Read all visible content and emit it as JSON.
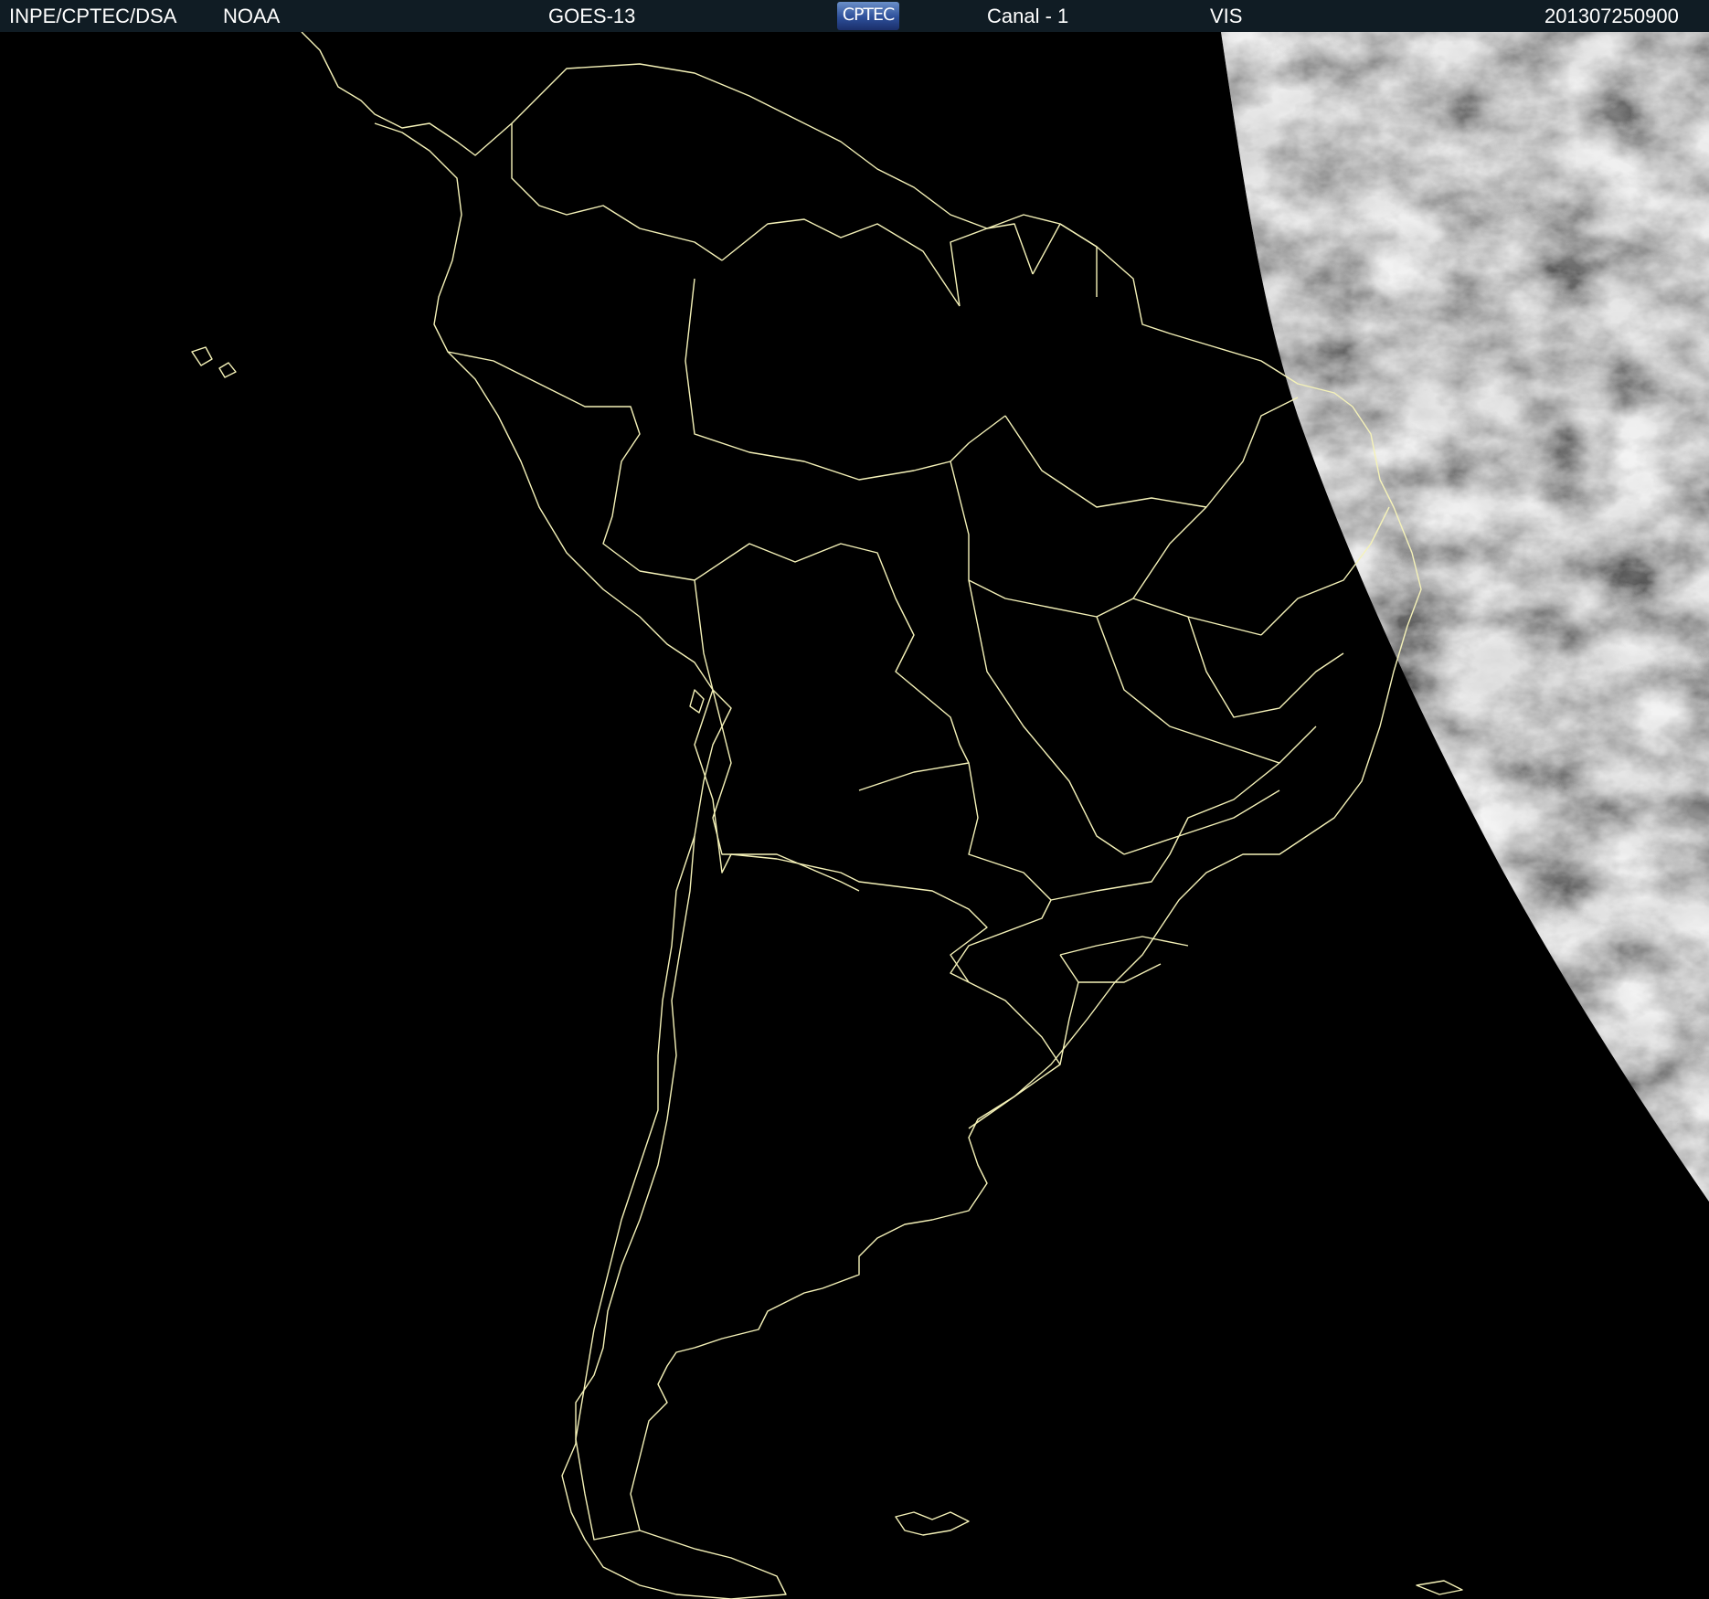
{
  "header": {
    "source": "INPE/CPTEC/DSA",
    "agency": "NOAA",
    "satellite": "GOES-13",
    "logo_text": "CPTEC",
    "channel": "Canal - 1",
    "band": "VIS",
    "timestamp": "201307250900"
  },
  "map": {
    "background_color": "#000000",
    "border_line_color": "#f5f2b8",
    "cloud_base_color": "#8a8a8a",
    "region": "South America"
  }
}
